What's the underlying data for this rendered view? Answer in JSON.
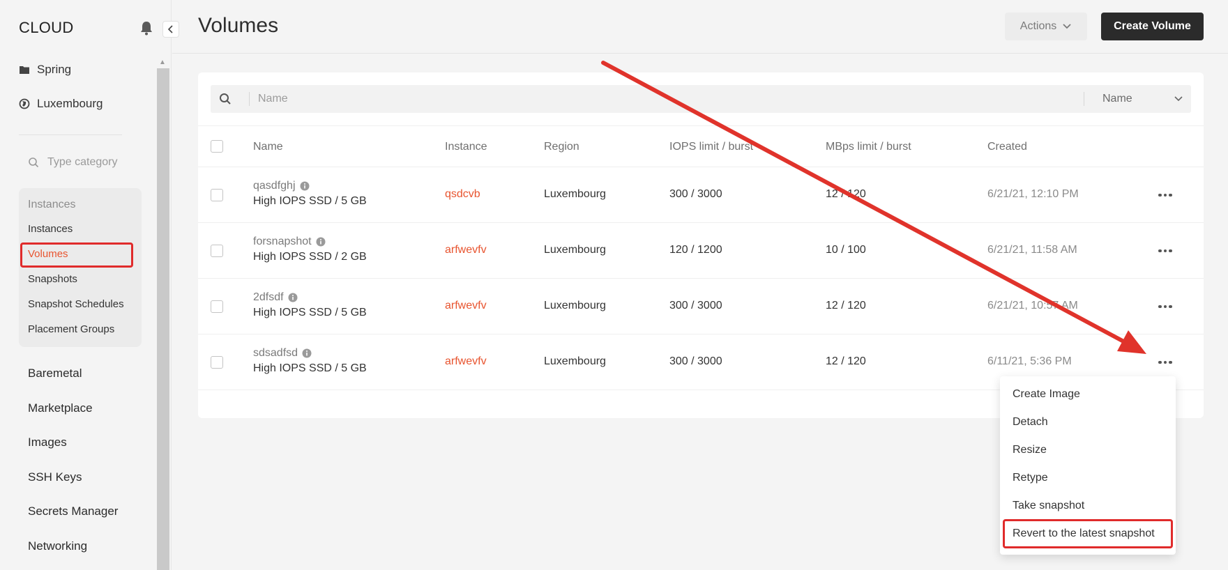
{
  "sidebar": {
    "logo": "CLOUD",
    "project": "Spring",
    "region": "Luxembourg",
    "category_search_placeholder": "Type category",
    "group": {
      "title": "Instances",
      "items": [
        "Instances",
        "Volumes",
        "Snapshots",
        "Snapshot Schedules",
        "Placement Groups"
      ],
      "active": "Volumes"
    },
    "nav": [
      "Baremetal",
      "Marketplace",
      "Images",
      "SSH Keys",
      "Secrets Manager",
      "Networking"
    ]
  },
  "header": {
    "title": "Volumes",
    "actions_label": "Actions",
    "create_label": "Create Volume"
  },
  "search": {
    "placeholder": "Name",
    "sort_by": "Name"
  },
  "table": {
    "columns": [
      "Name",
      "Instance",
      "Region",
      "IOPS limit / burst",
      "MBps limit / burst",
      "Created"
    ],
    "rows": [
      {
        "name": "qasdfghj",
        "type": "High IOPS SSD / 5 GB",
        "instance": "qsdcvb",
        "region": "Luxembourg",
        "iops": "300 / 3000",
        "mbps": "12 / 120",
        "created": "6/21/21, 12:10 PM"
      },
      {
        "name": "forsnapshot",
        "type": "High IOPS SSD / 2 GB",
        "instance": "arfwevfv",
        "region": "Luxembourg",
        "iops": "120 / 1200",
        "mbps": "10 / 100",
        "created": "6/21/21, 11:58 AM"
      },
      {
        "name": "2dfsdf",
        "type": "High IOPS SSD / 5 GB",
        "instance": "arfwevfv",
        "region": "Luxembourg",
        "iops": "300 / 3000",
        "mbps": "12 / 120",
        "created": "6/21/21, 10:57 AM"
      },
      {
        "name": "sdsadfsd",
        "type": "High IOPS SSD / 5 GB",
        "instance": "arfwevfv",
        "region": "Luxembourg",
        "iops": "300 / 3000",
        "mbps": "12 / 120",
        "created": "6/11/21, 5:36 PM"
      }
    ]
  },
  "context_menu": {
    "items": [
      "Create Image",
      "Detach",
      "Resize",
      "Retype",
      "Take snapshot",
      "Revert to the latest snapshot"
    ],
    "highlighted": "Revert to the latest snapshot"
  },
  "colors": {
    "accent": "#e8542f",
    "annotation": "#e02b2b",
    "primary_button": "#2b2b2b"
  }
}
